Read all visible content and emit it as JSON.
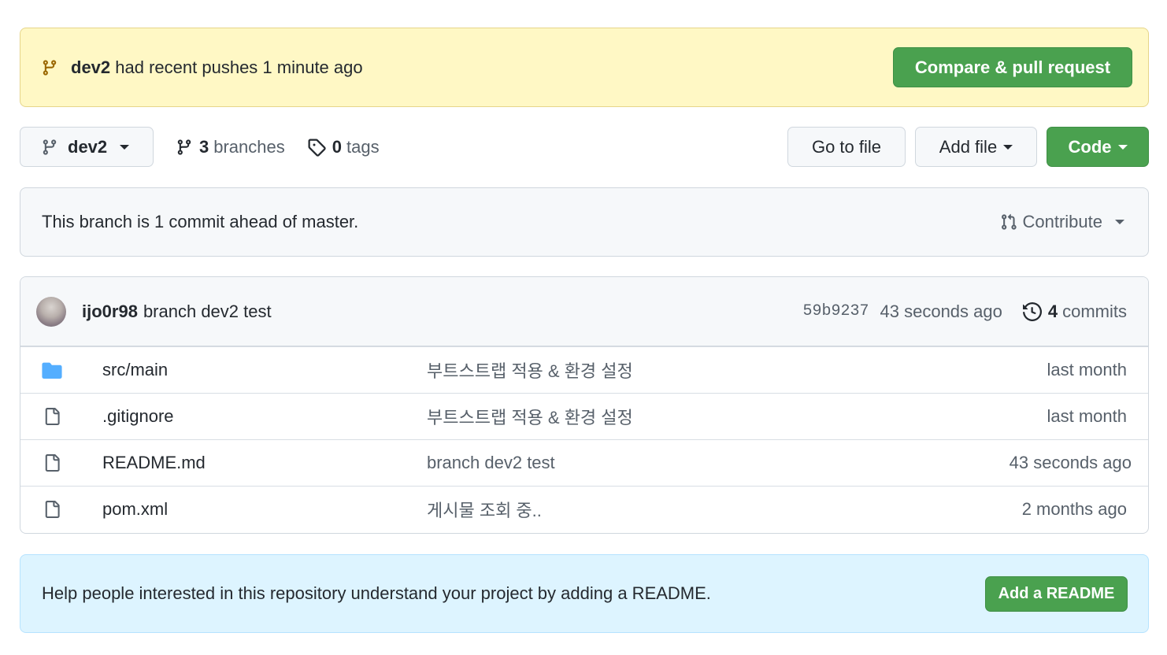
{
  "push_banner": {
    "branch": "dev2",
    "text": "had recent pushes 1 minute ago",
    "button": "Compare & pull request"
  },
  "toolbar": {
    "branch": "dev2",
    "branches_count": "3",
    "branches_label": "branches",
    "tags_count": "0",
    "tags_label": "tags",
    "go_to_file": "Go to file",
    "add_file": "Add file",
    "code": "Code"
  },
  "ahead": {
    "text": "This branch is 1 commit ahead of master.",
    "contribute": "Contribute"
  },
  "commit": {
    "author": "ijo0r98",
    "message": "branch dev2 test",
    "sha": "59b9237",
    "age": "43 seconds ago",
    "commits_count": "4",
    "commits_label": "commits"
  },
  "files": [
    {
      "icon": "folder-icon",
      "name": "src/main",
      "commit": "부트스트랩 적용 & 환경 설정",
      "age": "last month"
    },
    {
      "icon": "file-icon",
      "name": ".gitignore",
      "commit": "부트스트랩 적용 & 환경 설정",
      "age": "last month"
    },
    {
      "icon": "file-icon",
      "name": "README.md",
      "commit": "branch dev2 test",
      "age": "43 seconds ago"
    },
    {
      "icon": "file-icon",
      "name": "pom.xml",
      "commit": "게시물 조회 중..",
      "age": "2 months ago"
    }
  ],
  "readme": {
    "text": "Help people interested in this repository understand your project by adding a README.",
    "button": "Add a README"
  },
  "colors": {
    "green": "#4aa14f",
    "banner_yellow": "#fff8c5",
    "info_blue": "#ddf4ff",
    "folder_blue": "#54aeff"
  }
}
